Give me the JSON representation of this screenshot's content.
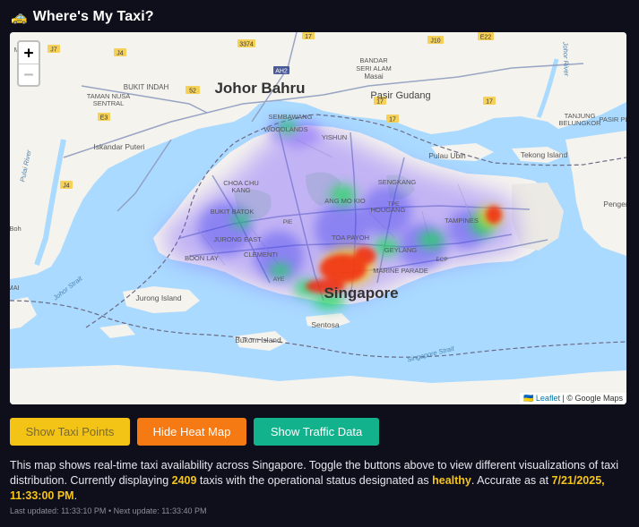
{
  "app": {
    "title": "Where's My Taxi?",
    "icon": "taxi-icon"
  },
  "map": {
    "zoom_in": "+",
    "zoom_out": "−",
    "attribution": {
      "flag": "🇺🇦",
      "leaflet": "Leaflet",
      "separator": "|",
      "provider": "© Google Maps"
    },
    "labels": {
      "johor_bahru": "Johor Bahru",
      "singapore": "Singapore",
      "pasir_gudang": "Pasir Gudang",
      "bandar_seri_alam": "BANDAR\nSERI ALAM",
      "masai": "Masai",
      "bukit_indah": "BUKIT INDAH",
      "taman_nusa_sentral": "TAMAN NUSA\nSENTRAL",
      "iskandar_puteri": "Iskandar Puteri",
      "sembawang": "SEMBAWANG",
      "woodlands": "WOODLANDS",
      "yishun": "YISHUN",
      "sengkang": "SENGKANG",
      "hougang": "HOUGANG",
      "ang_mo_kio": "ANG MO KIO",
      "choa_chu_kang": "CHOA CHU\nKANG",
      "bukit_batok": "BUKIT BATOK",
      "jurong_east": "JURONG EAST",
      "clementi": "CLEMENTI",
      "boon_lay": "BOON LAY",
      "toa_payoh": "TOA PAYOH",
      "geylang": "GEYLANG",
      "marine_parade": "MARINE PARADE",
      "tampines": "TAMPINES",
      "pulau_ubin": "Pulau Ubin",
      "tekong": "Tekong Island",
      "tanjung_belungkor": "TANJUNG\nBELUNGKOR",
      "pasir_pu": "PASIR PL",
      "pengerang": "Penger",
      "jurong_island": "Jurong Island",
      "bukom": "Bukom Island",
      "sentosa": "Sentosa",
      "johor_strait": "Johor Strait",
      "singapore_strait": "Singapore Strait",
      "pulai_river": "Pulai River",
      "johor_river": "Johor River",
      "tpe": "TPE",
      "pie": "PIE",
      "ecp": "ECP",
      "ayre": "AYE",
      "mai": "MAI",
      "eh_left": "MF",
      "boh": "Boh",
      "roads": [
        "3374",
        "J4",
        "J7",
        "17",
        "J10",
        "E22",
        "52",
        "E3",
        "AH2",
        "17",
        "17",
        "17",
        "J4"
      ]
    }
  },
  "buttons": {
    "show_taxi_points": "Show Taxi Points",
    "hide_heat_map": "Hide Heat Map",
    "show_traffic_data": "Show Traffic Data"
  },
  "description": {
    "part1": "This map shows real-time taxi availability across Singapore. Toggle the buttons above to view different visualizations of taxi distribution. Currently displaying ",
    "taxi_count": "2409",
    "part2": " taxis with the operational status designated as ",
    "status": "healthy",
    "part3": ". Accurate as at ",
    "timestamp": "7/21/2025, 11:33:00 PM",
    "part4": "."
  },
  "status_line": {
    "last_updated_label": "Last updated:",
    "last_updated": "11:33:10 PM",
    "separator": "•",
    "next_update_label": "Next update:",
    "next_update": "11:33:40 PM"
  },
  "colors": {
    "background": "#0f0f1c",
    "accent_yellow": "#f3c415",
    "accent_orange": "#f57a13",
    "accent_teal": "#12b28c",
    "water": "#aadaff",
    "land": "#f5f3ee"
  }
}
